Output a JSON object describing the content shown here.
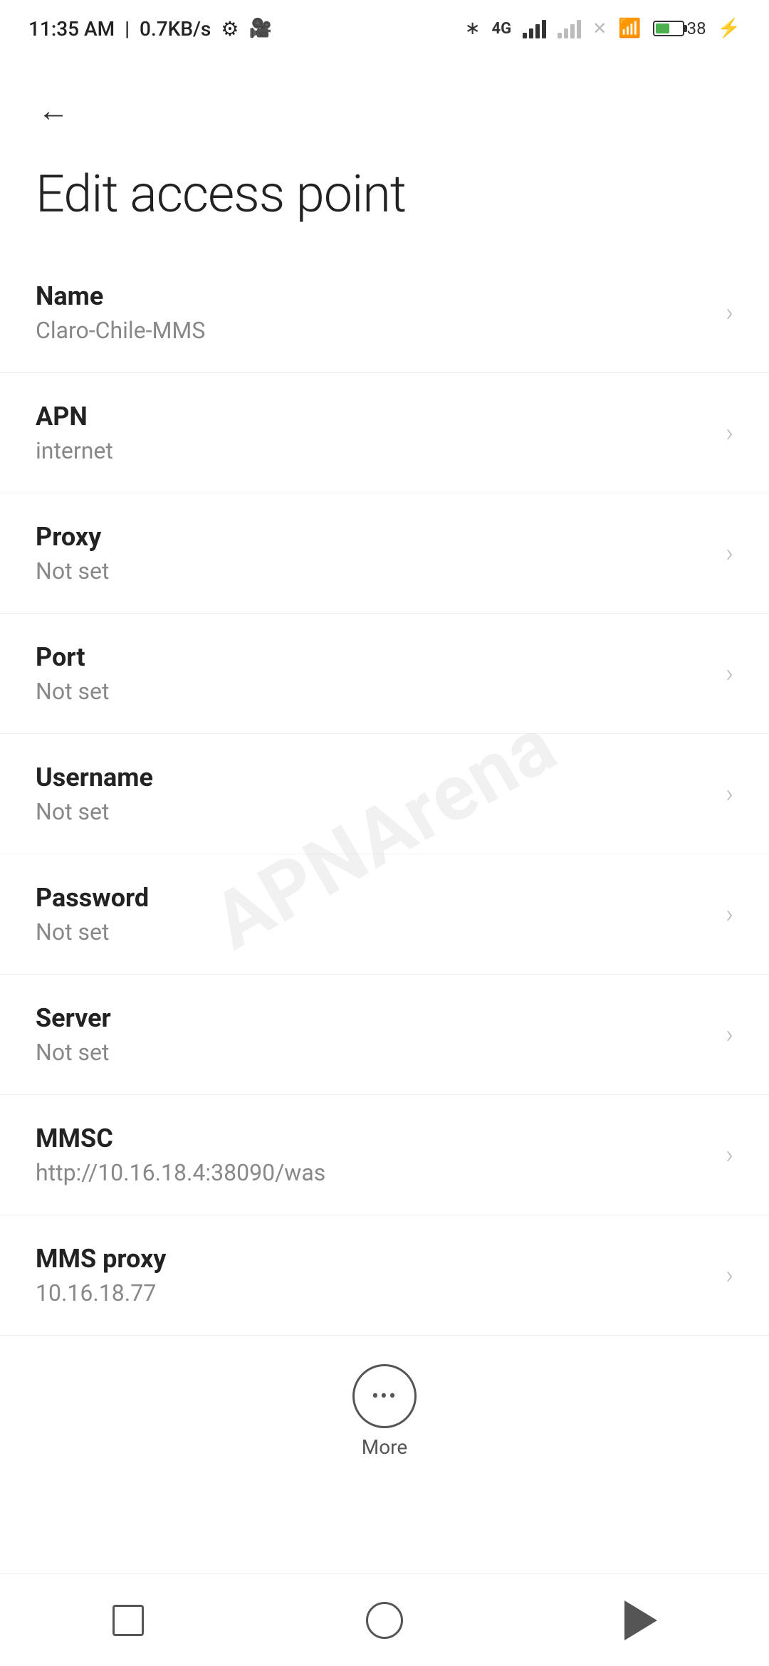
{
  "statusBar": {
    "time": "11:35 AM",
    "speed": "0.7KB/s",
    "batteryPercent": "38"
  },
  "header": {
    "backLabel": "←",
    "title": "Edit access point"
  },
  "more": {
    "label": "More"
  },
  "settings": {
    "items": [
      {
        "label": "Name",
        "value": "Claro-Chile-MMS"
      },
      {
        "label": "APN",
        "value": "internet"
      },
      {
        "label": "Proxy",
        "value": "Not set"
      },
      {
        "label": "Port",
        "value": "Not set"
      },
      {
        "label": "Username",
        "value": "Not set"
      },
      {
        "label": "Password",
        "value": "Not set"
      },
      {
        "label": "Server",
        "value": "Not set"
      },
      {
        "label": "MMSC",
        "value": "http://10.16.18.4:38090/was"
      },
      {
        "label": "MMS proxy",
        "value": "10.16.18.77"
      }
    ]
  },
  "navBar": {
    "squareLabel": "recent",
    "circleLabel": "home",
    "triangleLabel": "back"
  }
}
